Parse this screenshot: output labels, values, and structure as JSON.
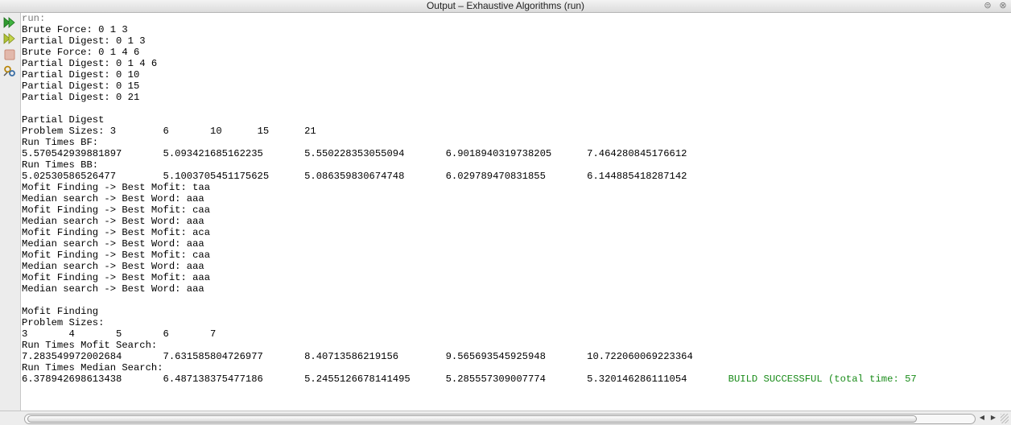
{
  "window": {
    "title": "Output – Exhaustive Algorithms (run)",
    "restore_icon": "⊜",
    "close_icon": "⊗"
  },
  "toolbar": {
    "icons": [
      "rerun-icon",
      "rerun-with-options-icon",
      "stop-icon",
      "settings-icon"
    ],
    "colors": {
      "run": "#2f9a2f",
      "rerun": "#b0c234",
      "stop": "#c98b78"
    }
  },
  "console": {
    "run_line": "run:",
    "lines": [
      "Brute Force: 0 1 3",
      "Partial Digest: 0 1 3",
      "Brute Force: 0 1 4 6",
      "Partial Digest: 0 1 4 6",
      "Partial Digest: 0 10",
      "Partial Digest: 0 15",
      "Partial Digest: 0 21",
      "",
      "Partial Digest",
      "Problem Sizes: 3\t6\t10\t15\t21",
      "Run Times BF:",
      "5.570542939881897\t5.093421685162235\t5.550228353055094\t6.9018940319738205\t7.464280845176612",
      "Run Times BB:",
      "5.02530586526477\t5.1003705451175625\t5.086359830674748\t6.029789470831855\t6.144885418287142",
      "Mofit Finding -> Best Mofit: taa",
      "Median search -> Best Word: aaa",
      "Mofit Finding -> Best Mofit: caa",
      "Median search -> Best Word: aaa",
      "Mofit Finding -> Best Mofit: aca",
      "Median search -> Best Word: aaa",
      "Mofit Finding -> Best Mofit: caa",
      "Median search -> Best Word: aaa",
      "Mofit Finding -> Best Mofit: aaa",
      "Median search -> Best Word: aaa",
      "",
      "Mofit Finding",
      "Problem Sizes:",
      "3\t4\t5\t6\t7",
      "Run Times Mofit Search:",
      "7.283549972002684\t7.631585804726977\t8.40713586219156\t9.565693545925948\t10.722060069223364",
      "Run Times Median Search:"
    ],
    "last_line": "6.378942698613438\t6.487138375477186\t5.2455126678141495\t5.285557309007774\t5.320146286111054\t",
    "build_status": "BUILD SUCCESSFUL (total time: 57",
    "build_color": "#1a8c1a"
  },
  "scrollbar": {
    "left_arrow": "◀",
    "right_arrow": "▶"
  }
}
